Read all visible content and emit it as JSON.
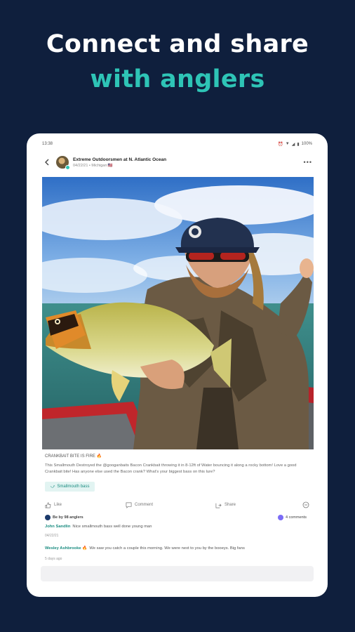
{
  "headline": {
    "line1": "Connect and share",
    "line2": "with anglers"
  },
  "statusbar": {
    "time": "13:38",
    "battery": "100%"
  },
  "post": {
    "author": "Extreme Outdoorsmen at N. Atlantic Ocean",
    "subtitle": "04/22/21 • Michigan 🇺🇸",
    "caption_title": "CRANKBAIT BITE IS FIRE 🔥",
    "caption_body": "This Smallmouth Destroyed the @googanbaits Bacon Crankbait throwing it in 8-12ft of Water bouncing it along a rocky bottom! Love a good Crankbait bite! Has anyone else used the Bacon crank? What's your biggest bass on this lure?",
    "tag": "Smallmouth bass"
  },
  "actions": {
    "like": "Like",
    "comment": "Comment",
    "share": "Share"
  },
  "meta": {
    "liked_by": "Be by 98 anglers",
    "comments_count": "4 comments"
  },
  "comments": [
    {
      "name": "John Sandlin",
      "text": "Nice smallmouth bass well done young man",
      "time": "04/22/21"
    },
    {
      "name": "Wesley Ashbrooke 🔥",
      "text": "We saw you catch a couple this morning. We were next to you by the booeys. Big fans",
      "time": "5 days ago"
    }
  ],
  "colors": {
    "background": "#0f1f3d",
    "accent": "#2ec4b6",
    "card": "#ffffff"
  }
}
